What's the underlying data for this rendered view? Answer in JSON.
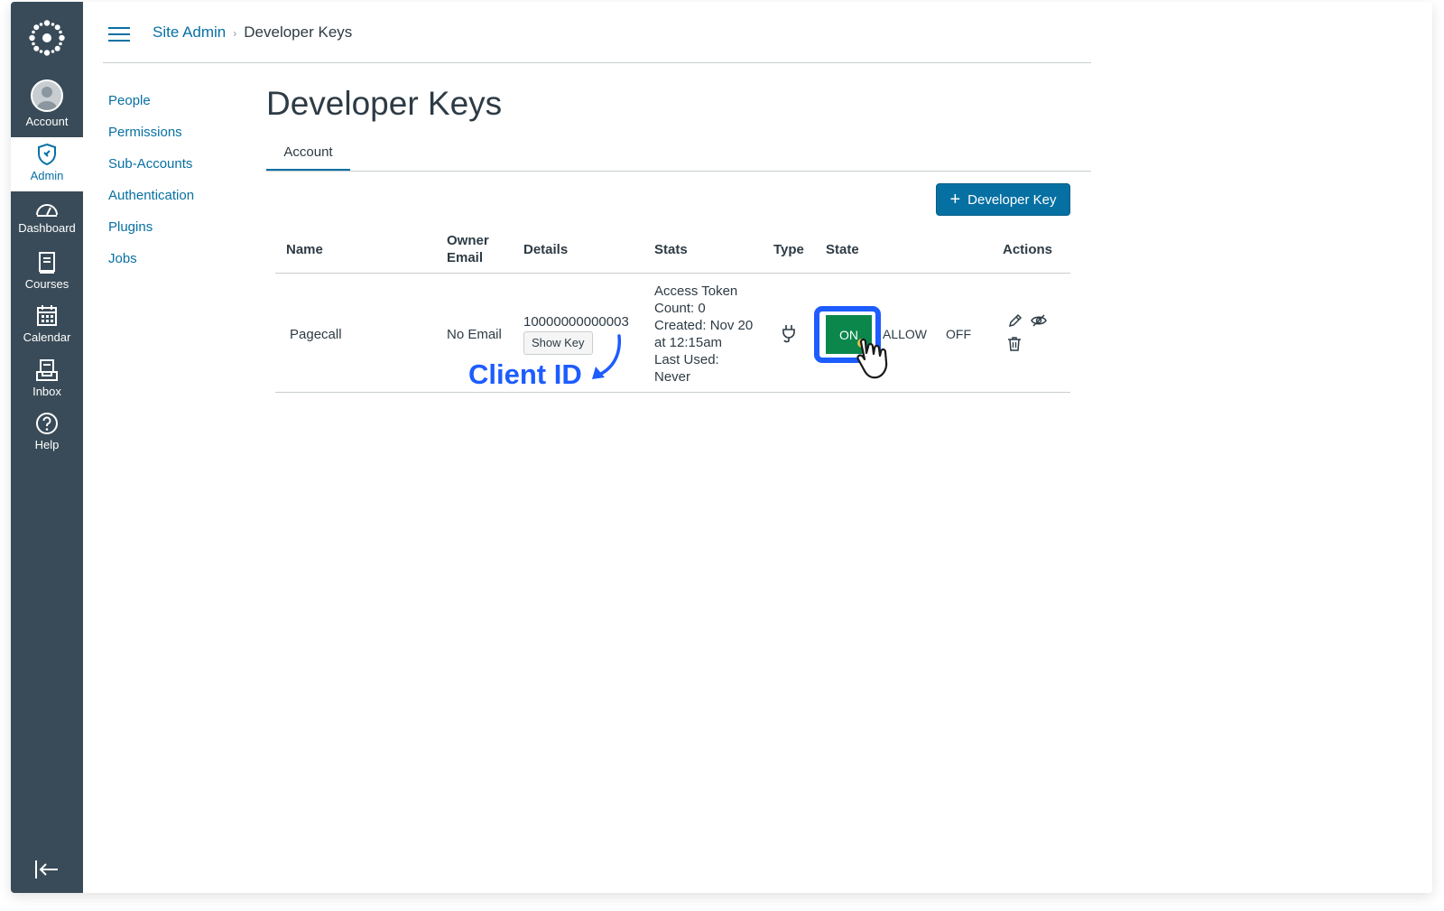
{
  "nav": {
    "account": "Account",
    "admin": "Admin",
    "dashboard": "Dashboard",
    "courses": "Courses",
    "calendar": "Calendar",
    "inbox": "Inbox",
    "help": "Help"
  },
  "breadcrumb": {
    "root": "Site Admin",
    "separator": "›",
    "current": "Developer Keys"
  },
  "section_nav": [
    "People",
    "Permissions",
    "Sub-Accounts",
    "Authentication",
    "Plugins",
    "Jobs"
  ],
  "page": {
    "title": "Developer Keys",
    "tab": "Account",
    "add_button": "Developer Key",
    "add_button_icon": "+"
  },
  "table": {
    "headers": {
      "name": "Name",
      "owner_email_line1": "Owner",
      "owner_email_line2": "Email",
      "details": "Details",
      "stats": "Stats",
      "type": "Type",
      "state": "State",
      "actions": "Actions"
    },
    "row": {
      "name": "Pagecall",
      "owner_email": "No Email",
      "client_id": "10000000000003",
      "show_key": "Show Key",
      "stats": [
        "Access Token",
        "Count: 0",
        "Created: Nov 20",
        "at 12:15am",
        "Last Used:",
        "Never"
      ],
      "type_icon": "plug-icon",
      "state_on": "ON",
      "state_allow": "ALLOW",
      "state_off": "OFF"
    }
  },
  "annotation": {
    "label": "Client ID"
  },
  "colors": {
    "nav_bg": "#394b58",
    "link": "#0770a3",
    "on_green": "#0b874b",
    "highlight": "#1d5cff"
  }
}
